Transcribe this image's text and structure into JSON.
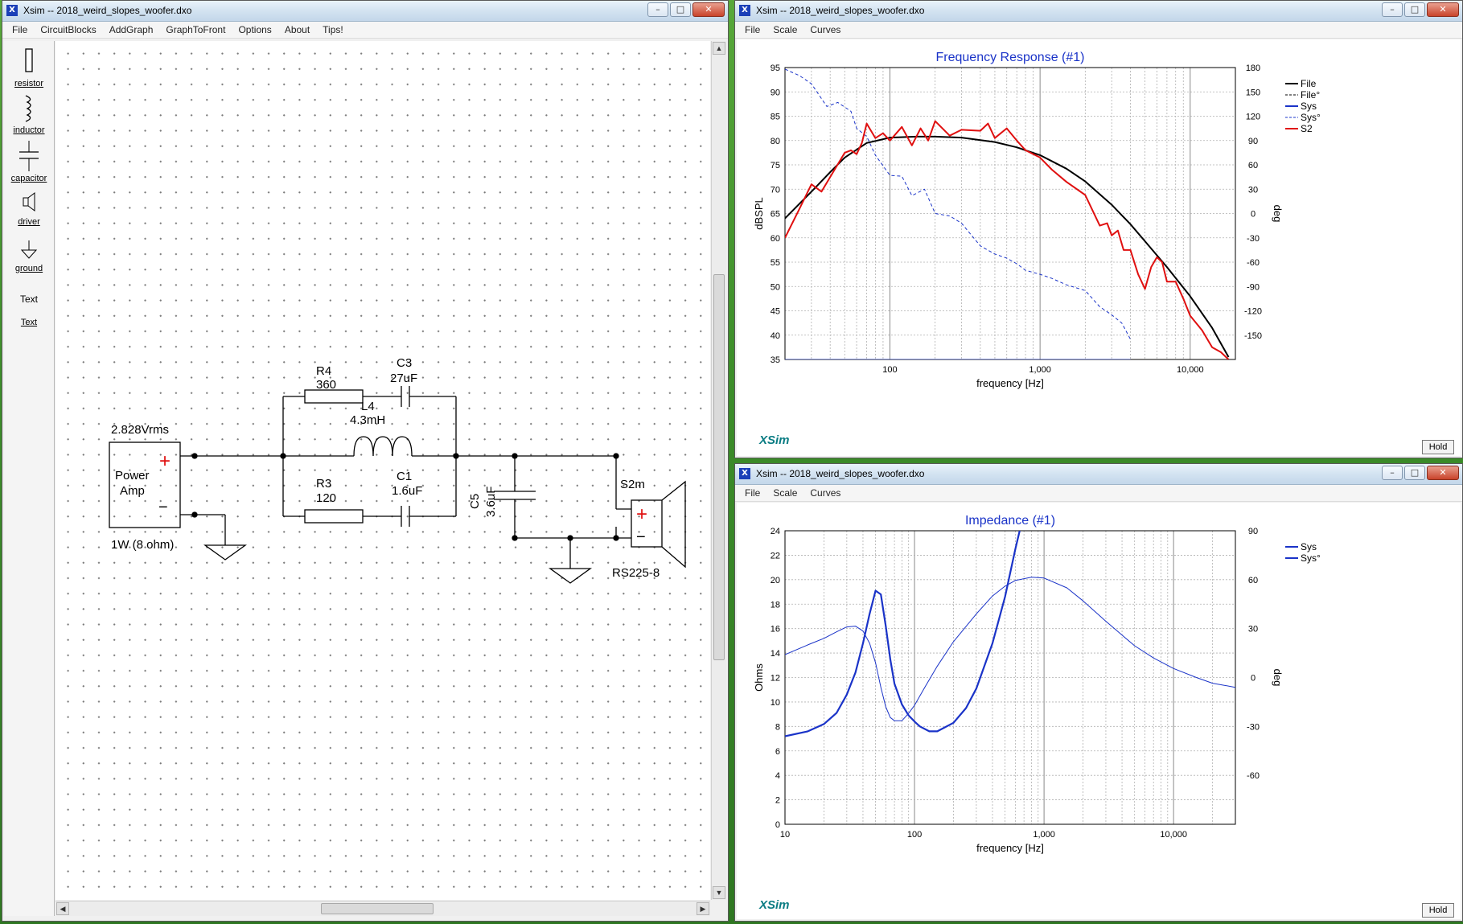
{
  "colors": {
    "accent_blue": "#1a33c8",
    "trace_red": "#e01010",
    "trace_black": "#000000",
    "title_blue": "#1a33c8",
    "logo_teal": "#0a7c83"
  },
  "schematic_window": {
    "title": "Xsim -- 2018_weird_slopes_woofer.dxo",
    "menu": [
      "File",
      "CircuitBlocks",
      "AddGraph",
      "GraphToFront",
      "Options",
      "About",
      "Tips!"
    ],
    "tools": [
      {
        "label": "resistor",
        "icon": "resistor-icon"
      },
      {
        "label": "inductor",
        "icon": "inductor-icon"
      },
      {
        "label": "capacitor",
        "icon": "capacitor-icon"
      },
      {
        "label": "driver",
        "icon": "driver-icon"
      },
      {
        "label": "ground",
        "icon": "ground-icon"
      },
      {
        "label": "Text",
        "icon": "text-icon"
      },
      {
        "label": "Text",
        "icon": "text-link-icon"
      }
    ],
    "circuit": {
      "source_voltage": "2.828Vrms",
      "amp_label_1": "Power",
      "amp_label_2": "Amp",
      "amp_power": "1W (8 ohm)",
      "plus": "+",
      "minus": "−",
      "r4_name": "R4",
      "r4_value": "360",
      "c3_name": "C3",
      "c3_value": "27uF",
      "l4_name": "L4",
      "l4_value": "4.3mH",
      "r3_name": "R3",
      "r3_value": "120",
      "c1_name": "C1",
      "c1_value": "1.6uF",
      "c5_name": "C5",
      "c5_value": "3.6uF",
      "driver_name": "S2m",
      "driver_model": "RS225-8"
    }
  },
  "freq_window": {
    "title": "Xsim -- 2018_weird_slopes_woofer.dxo",
    "menu": [
      "File",
      "Scale",
      "Curves"
    ],
    "logo": "XSim",
    "hold": "Hold"
  },
  "imp_window": {
    "title": "Xsim -- 2018_weird_slopes_woofer.dxo",
    "menu": [
      "File",
      "Scale",
      "Curves"
    ],
    "logo": "XSim",
    "hold": "Hold"
  },
  "chart_data": [
    {
      "type": "line",
      "title": "Frequency Response (#1)",
      "xlabel": "frequency [Hz]",
      "ylabel": "dBSPL",
      "y2label": "deg",
      "xscale": "log",
      "xlim": [
        20,
        20000
      ],
      "ylim": [
        35,
        95
      ],
      "y2lim": [
        -180,
        180
      ],
      "x_tick_labels": [
        "100",
        "1,000",
        "10,000"
      ],
      "x_tick_values": [
        100,
        1000,
        10000
      ],
      "y_ticks": [
        35,
        40,
        45,
        50,
        55,
        60,
        65,
        70,
        75,
        80,
        85,
        90,
        95
      ],
      "y2_ticks": [
        -150,
        -120,
        -90,
        -60,
        -30,
        0,
        30,
        60,
        90,
        120,
        150,
        180
      ],
      "grid": true,
      "legend": "right",
      "series": [
        {
          "name": "File",
          "axis": "left",
          "color": "#000000",
          "style": "solid",
          "width": 2,
          "x": [
            20,
            30,
            40,
            50,
            70,
            100,
            150,
            200,
            300,
            500,
            700,
            1000,
            1500,
            2000,
            3000,
            4000,
            5000,
            7000,
            10000,
            14000,
            18000
          ],
          "y": [
            64,
            69.5,
            73.5,
            76.5,
            79.5,
            80.6,
            80.8,
            80.8,
            80.6,
            79.7,
            78.6,
            77,
            74.2,
            71.6,
            66.8,
            62.8,
            59.3,
            54,
            48,
            41.5,
            35.5
          ]
        },
        {
          "name": "File°",
          "axis": "right",
          "color": "#000000",
          "style": "dashed",
          "width": 1,
          "x": [],
          "y": []
        },
        {
          "name": "Sys",
          "axis": "left",
          "color": "#1a33c8",
          "style": "solid",
          "width": 1,
          "x": [
            20,
            30,
            40,
            55,
            60,
            70,
            80,
            100,
            120,
            140,
            160,
            200,
            250,
            300,
            400,
            500,
            600,
            700,
            800,
            1000,
            1200,
            1500,
            2000,
            2500,
            3000,
            3500,
            4000
          ],
          "y": [
            35,
            35,
            35,
            35,
            35,
            35,
            35,
            35,
            35,
            35,
            35,
            35,
            35,
            35,
            35,
            35,
            35,
            35,
            35,
            35,
            35,
            35,
            35,
            35,
            35,
            35,
            35
          ]
        },
        {
          "name": "Sys°",
          "axis": "right",
          "color": "#1a33c8",
          "style": "dashed",
          "width": 1,
          "x": [
            20,
            25,
            30,
            38,
            45,
            55,
            60,
            70,
            80,
            100,
            120,
            140,
            170,
            200,
            250,
            300,
            400,
            500,
            600,
            700,
            800,
            1000,
            1200,
            1500,
            2000,
            2500,
            3000,
            3500,
            4000
          ],
          "y": [
            178,
            170,
            160,
            132,
            137,
            126,
            105,
            95,
            72,
            47,
            46,
            22,
            30,
            0,
            -3,
            -12,
            -40,
            -50,
            -55,
            -62,
            -70,
            -75,
            -80,
            -88,
            -95,
            -115,
            -125,
            -135,
            -155
          ]
        },
        {
          "name": "S2",
          "axis": "left",
          "color": "#e01010",
          "style": "solid",
          "width": 2,
          "x": [
            20,
            25,
            30,
            35,
            40,
            50,
            55,
            60,
            65,
            70,
            80,
            90,
            100,
            120,
            140,
            160,
            180,
            200,
            250,
            300,
            400,
            450,
            500,
            600,
            700,
            800,
            1000,
            1200,
            1500,
            2000,
            2500,
            2800,
            3000,
            3300,
            3600,
            4000,
            4500,
            5000,
            5500,
            6000,
            6500,
            7000,
            8000,
            9000,
            10000,
            12000,
            14000,
            16000,
            18000
          ],
          "y": [
            60,
            66,
            71,
            69.5,
            72.5,
            77.5,
            78,
            77.2,
            79.5,
            83.5,
            80.5,
            81.5,
            80,
            82.8,
            79,
            82.5,
            80,
            84,
            81,
            82.2,
            82,
            83.5,
            80.5,
            82.5,
            80,
            78,
            76.5,
            74,
            71.5,
            68.8,
            62.5,
            63,
            60.5,
            61.5,
            57.5,
            57.5,
            52.5,
            49.5,
            54,
            56,
            55,
            51,
            51,
            47.5,
            44,
            41,
            37.5,
            36.5,
            35
          ]
        }
      ]
    },
    {
      "type": "line",
      "title": "Impedance (#1)",
      "xlabel": "frequency [Hz]",
      "ylabel": "Ohms",
      "y2label": "deg",
      "xscale": "log",
      "xlim": [
        10,
        30000
      ],
      "ylim": [
        0,
        24
      ],
      "y2lim": [
        -90,
        90
      ],
      "x_tick_labels": [
        "10",
        "100",
        "1,000",
        "10,000"
      ],
      "x_tick_values": [
        10,
        100,
        1000,
        10000
      ],
      "y_ticks": [
        0,
        2,
        4,
        6,
        8,
        10,
        12,
        14,
        16,
        18,
        20,
        22,
        24
      ],
      "y2_ticks": [
        -60,
        -30,
        0,
        30,
        60,
        90
      ],
      "grid": true,
      "legend": "right",
      "series": [
        {
          "name": "Sys",
          "axis": "left",
          "color": "#1a33c8",
          "style": "solid",
          "width": 2.2,
          "x": [
            10,
            15,
            20,
            25,
            30,
            35,
            40,
            45,
            50,
            55,
            60,
            65,
            70,
            80,
            90,
            100,
            110,
            130,
            150,
            200,
            250,
            300,
            400,
            500,
            600,
            700,
            800
          ],
          "y": [
            7.2,
            7.6,
            8.2,
            9.1,
            10.6,
            12.4,
            14.8,
            17.2,
            19.1,
            18.8,
            16.2,
            13.5,
            11.5,
            9.8,
            8.9,
            8.4,
            8.0,
            7.6,
            7.6,
            8.3,
            9.5,
            11.1,
            14.8,
            18.6,
            22.5,
            25.5,
            27
          ]
        },
        {
          "name": "Sys°",
          "axis": "right",
          "color": "#1a33c8",
          "style": "solid",
          "width": 1,
          "x": [
            10,
            15,
            20,
            25,
            30,
            35,
            40,
            45,
            50,
            55,
            60,
            65,
            70,
            80,
            90,
            100,
            120,
            150,
            200,
            300,
            400,
            500,
            600,
            800,
            1000,
            1500,
            2000,
            3000,
            4000,
            5000,
            7000,
            10000,
            15000,
            20000,
            30000
          ],
          "y": [
            14,
            20,
            24,
            28,
            31,
            31.5,
            28.5,
            21,
            9,
            -6,
            -18,
            -24.5,
            -26.5,
            -26.5,
            -22,
            -17,
            -6,
            7,
            22,
            39,
            50,
            56,
            59.5,
            61.5,
            61,
            55,
            47,
            34.5,
            26,
            19.5,
            12,
            5.5,
            0,
            -3.5,
            -6
          ]
        }
      ]
    }
  ]
}
